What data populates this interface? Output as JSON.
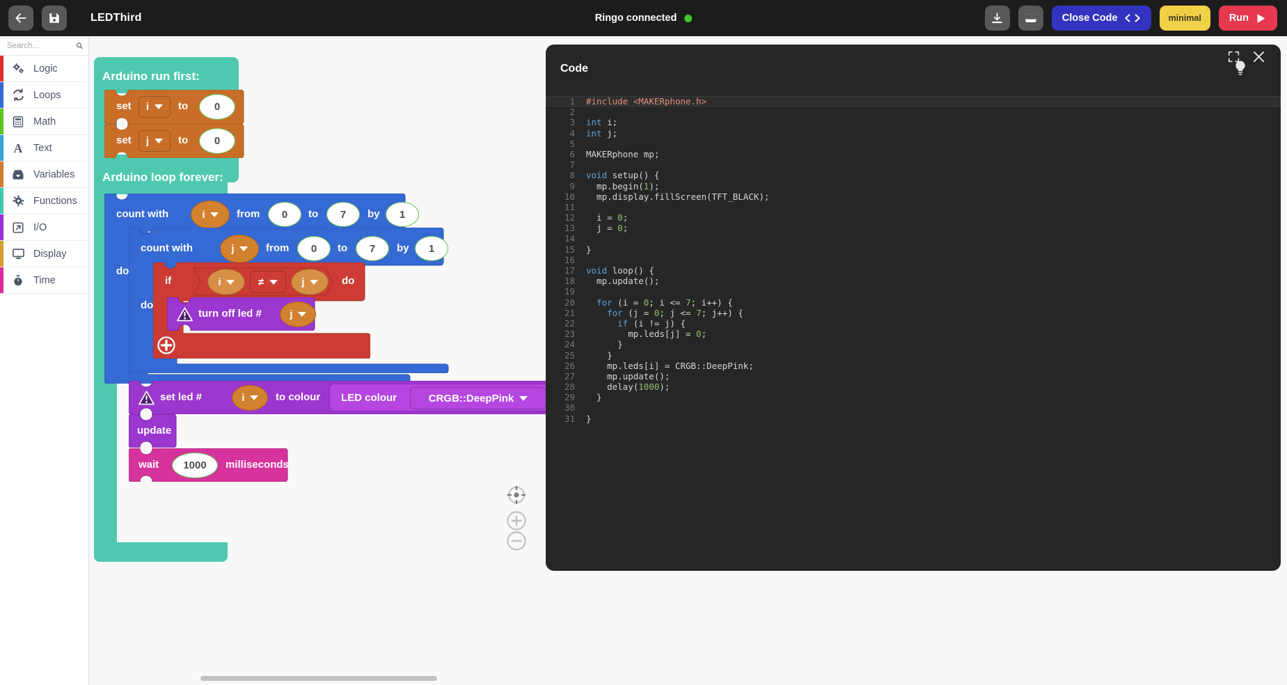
{
  "topbar": {
    "back_icon": "arrow-left-icon",
    "save_icon": "floppy-disk-icon",
    "project_title": "LEDThird",
    "connection_text": "Ringo connected",
    "connection_color": "#3ec72b",
    "download_icon": "download-icon",
    "serial_icon": "serial-monitor-icon",
    "close_code_label": "Close Code",
    "minimal_label": "minimal",
    "run_label": "Run"
  },
  "sidebar": {
    "search_placeholder": "Search...",
    "search_value": "",
    "search_icon": "search-icon",
    "items": [
      {
        "label": "Logic",
        "icon": "gears-icon",
        "color": "#d9302c"
      },
      {
        "label": "Loops",
        "icon": "refresh-icon",
        "color": "#3569d4"
      },
      {
        "label": "Math",
        "icon": "calculator-icon",
        "color": "#5cc41f"
      },
      {
        "label": "Text",
        "icon": "letter-a-icon",
        "color": "#36a3d9"
      },
      {
        "label": "Variables",
        "icon": "inbox-icon",
        "color": "#d2792f"
      },
      {
        "label": "Functions",
        "icon": "gear-icon",
        "color": "#3fc9b0"
      },
      {
        "label": "I/O",
        "icon": "arrow-out-icon",
        "color": "#9b30d9"
      },
      {
        "label": "Display",
        "icon": "monitor-icon",
        "color": "#d1a12c"
      },
      {
        "label": "Time",
        "icon": "stopwatch-icon",
        "color": "#e02a9c"
      }
    ]
  },
  "workspace": {
    "hat_setup_label": "Arduino run first:",
    "hat_loop_label": "Arduino loop forever:",
    "set_i": {
      "verb": "set",
      "var": "i",
      "to": "to",
      "value": "0"
    },
    "set_j": {
      "verb": "set",
      "var": "j",
      "to": "to",
      "value": "0"
    },
    "for_i": {
      "count_with": "count with",
      "var": "i",
      "from": "from",
      "from_val": "0",
      "to": "to",
      "to_val": "7",
      "by": "by",
      "by_val": "1",
      "do": "do"
    },
    "for_j": {
      "count_with": "count with",
      "var": "j",
      "from": "from",
      "from_val": "0",
      "to": "to",
      "to_val": "7",
      "by": "by",
      "by_val": "1",
      "do": "do"
    },
    "if_block": {
      "if": "if",
      "left_var": "i",
      "operator": "≠",
      "right_var": "j",
      "do": "do",
      "plus_icon": "add-circle-icon"
    },
    "turn_off": {
      "label": "turn off led #",
      "var": "j",
      "warning_icon": "warning-triangle-icon"
    },
    "set_led": {
      "label": "set led #",
      "var": "i",
      "to_colour": "to colour",
      "colour_label": "LED colour",
      "colour_value": "CRGB::DeepPink",
      "warning_icon": "warning-triangle-icon"
    },
    "update_label": "update",
    "wait": {
      "verb": "wait",
      "value": "1000",
      "unit": "milliseconds"
    },
    "controls": {
      "center_icon": "crosshair-icon",
      "zoom_in_icon": "plus-icon",
      "zoom_out_icon": "minus-icon"
    }
  },
  "code_panel": {
    "title": "Code",
    "bulb_icon": "lightbulb-icon",
    "expand_icon": "fullscreen-icon",
    "close_icon": "close-icon",
    "lines": [
      {
        "n": 1,
        "text": "#include <MAKERphone.h>"
      },
      {
        "n": 2,
        "text": ""
      },
      {
        "n": 3,
        "text": "int i;"
      },
      {
        "n": 4,
        "text": "int j;"
      },
      {
        "n": 5,
        "text": ""
      },
      {
        "n": 6,
        "text": "MAKERphone mp;"
      },
      {
        "n": 7,
        "text": ""
      },
      {
        "n": 8,
        "text": "void setup() {"
      },
      {
        "n": 9,
        "text": "  mp.begin(1);"
      },
      {
        "n": 10,
        "text": "  mp.display.fillScreen(TFT_BLACK);"
      },
      {
        "n": 11,
        "text": ""
      },
      {
        "n": 12,
        "text": "  i = 0;"
      },
      {
        "n": 13,
        "text": "  j = 0;"
      },
      {
        "n": 14,
        "text": ""
      },
      {
        "n": 15,
        "text": "}"
      },
      {
        "n": 16,
        "text": ""
      },
      {
        "n": 17,
        "text": "void loop() {"
      },
      {
        "n": 18,
        "text": "  mp.update();"
      },
      {
        "n": 19,
        "text": ""
      },
      {
        "n": 20,
        "text": "  for (i = 0; i <= 7; i++) {"
      },
      {
        "n": 21,
        "text": "    for (j = 0; j <= 7; j++) {"
      },
      {
        "n": 22,
        "text": "      if (i != j) {"
      },
      {
        "n": 23,
        "text": "        mp.leds[j] = 0;"
      },
      {
        "n": 24,
        "text": "      }"
      },
      {
        "n": 25,
        "text": "    }"
      },
      {
        "n": 26,
        "text": "    mp.leds[i] = CRGB::DeepPink;"
      },
      {
        "n": 27,
        "text": "    mp.update();"
      },
      {
        "n": 28,
        "text": "    delay(1000);"
      },
      {
        "n": 29,
        "text": "  }"
      },
      {
        "n": 30,
        "text": ""
      },
      {
        "n": 31,
        "text": "}"
      }
    ]
  }
}
